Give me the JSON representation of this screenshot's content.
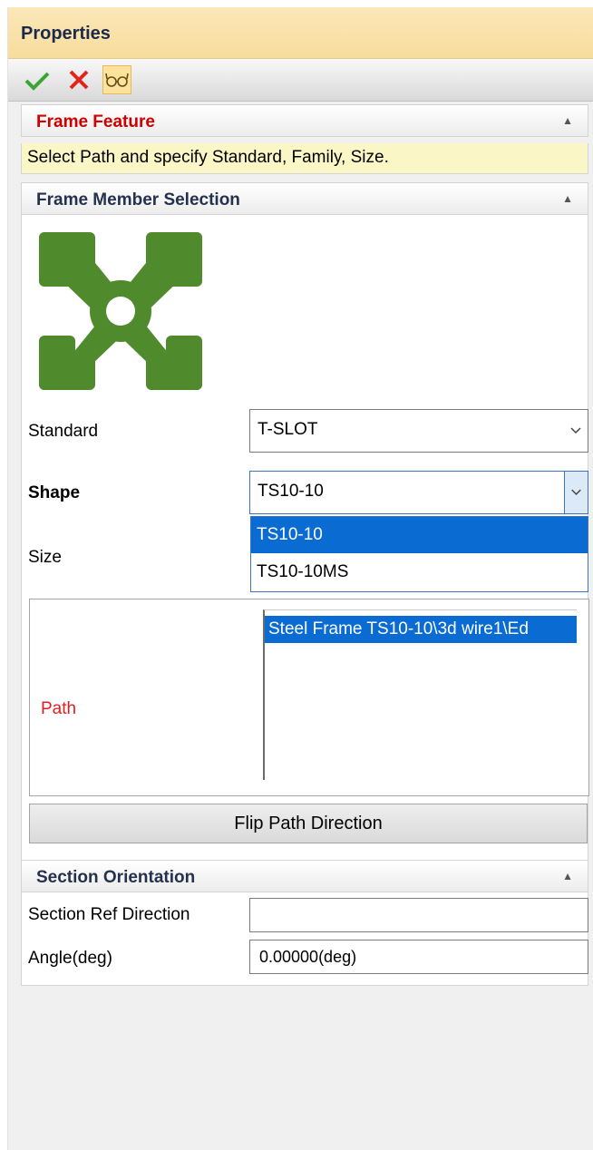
{
  "panel": {
    "title": "Properties"
  },
  "toolbar": {
    "ok_icon": "check-icon",
    "cancel_icon": "close-icon",
    "preview_icon": "glasses-icon"
  },
  "frame_feature": {
    "header": "Frame Feature",
    "hint": "Select Path and specify Standard, Family, Size."
  },
  "frame_member": {
    "header": "Frame Member Selection",
    "profile_icon": "tslot-profile-icon",
    "standard_label": "Standard",
    "standard_value": "T-SLOT",
    "shape_label": "Shape",
    "shape_value": "TS10-10",
    "size_label": "Size",
    "shape_options": [
      "TS10-10",
      "TS10-10MS"
    ],
    "path_label": "Path",
    "path_items": [
      "Steel Frame TS10-10\\3d wire1\\Ed"
    ],
    "flip_button": "Flip Path Direction"
  },
  "section_orientation": {
    "header": "Section Orientation",
    "ref_label": "Section Ref Direction",
    "ref_value": "",
    "angle_label": "Angle(deg)",
    "angle_value": "0.00000(deg)"
  },
  "colors": {
    "header_gradient": "#f7dc9c",
    "selection": "#0a6bd2",
    "required_red": "#d00000",
    "profile_green": "#4f8a2c"
  }
}
